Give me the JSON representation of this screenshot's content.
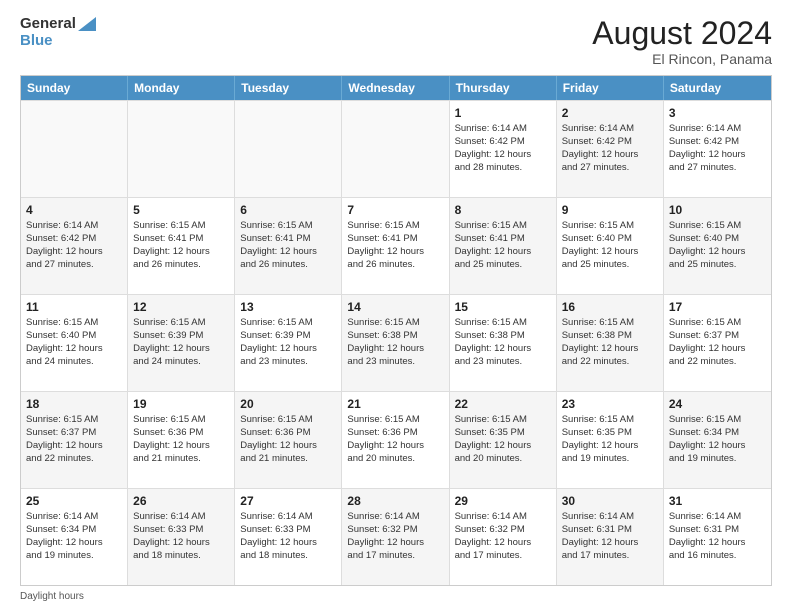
{
  "header": {
    "logo_line1": "General",
    "logo_line2": "Blue",
    "month_year": "August 2024",
    "location": "El Rincon, Panama"
  },
  "days_of_week": [
    "Sunday",
    "Monday",
    "Tuesday",
    "Wednesday",
    "Thursday",
    "Friday",
    "Saturday"
  ],
  "footer": {
    "note": "Daylight hours"
  },
  "weeks": [
    [
      {
        "day": "",
        "info": "",
        "shaded": false
      },
      {
        "day": "",
        "info": "",
        "shaded": false
      },
      {
        "day": "",
        "info": "",
        "shaded": false
      },
      {
        "day": "",
        "info": "",
        "shaded": false
      },
      {
        "day": "1",
        "info": "Sunrise: 6:14 AM\nSunset: 6:42 PM\nDaylight: 12 hours\nand 28 minutes.",
        "shaded": false
      },
      {
        "day": "2",
        "info": "Sunrise: 6:14 AM\nSunset: 6:42 PM\nDaylight: 12 hours\nand 27 minutes.",
        "shaded": true
      },
      {
        "day": "3",
        "info": "Sunrise: 6:14 AM\nSunset: 6:42 PM\nDaylight: 12 hours\nand 27 minutes.",
        "shaded": false
      }
    ],
    [
      {
        "day": "4",
        "info": "Sunrise: 6:14 AM\nSunset: 6:42 PM\nDaylight: 12 hours\nand 27 minutes.",
        "shaded": true
      },
      {
        "day": "5",
        "info": "Sunrise: 6:15 AM\nSunset: 6:41 PM\nDaylight: 12 hours\nand 26 minutes.",
        "shaded": false
      },
      {
        "day": "6",
        "info": "Sunrise: 6:15 AM\nSunset: 6:41 PM\nDaylight: 12 hours\nand 26 minutes.",
        "shaded": true
      },
      {
        "day": "7",
        "info": "Sunrise: 6:15 AM\nSunset: 6:41 PM\nDaylight: 12 hours\nand 26 minutes.",
        "shaded": false
      },
      {
        "day": "8",
        "info": "Sunrise: 6:15 AM\nSunset: 6:41 PM\nDaylight: 12 hours\nand 25 minutes.",
        "shaded": true
      },
      {
        "day": "9",
        "info": "Sunrise: 6:15 AM\nSunset: 6:40 PM\nDaylight: 12 hours\nand 25 minutes.",
        "shaded": false
      },
      {
        "day": "10",
        "info": "Sunrise: 6:15 AM\nSunset: 6:40 PM\nDaylight: 12 hours\nand 25 minutes.",
        "shaded": true
      }
    ],
    [
      {
        "day": "11",
        "info": "Sunrise: 6:15 AM\nSunset: 6:40 PM\nDaylight: 12 hours\nand 24 minutes.",
        "shaded": false
      },
      {
        "day": "12",
        "info": "Sunrise: 6:15 AM\nSunset: 6:39 PM\nDaylight: 12 hours\nand 24 minutes.",
        "shaded": true
      },
      {
        "day": "13",
        "info": "Sunrise: 6:15 AM\nSunset: 6:39 PM\nDaylight: 12 hours\nand 23 minutes.",
        "shaded": false
      },
      {
        "day": "14",
        "info": "Sunrise: 6:15 AM\nSunset: 6:38 PM\nDaylight: 12 hours\nand 23 minutes.",
        "shaded": true
      },
      {
        "day": "15",
        "info": "Sunrise: 6:15 AM\nSunset: 6:38 PM\nDaylight: 12 hours\nand 23 minutes.",
        "shaded": false
      },
      {
        "day": "16",
        "info": "Sunrise: 6:15 AM\nSunset: 6:38 PM\nDaylight: 12 hours\nand 22 minutes.",
        "shaded": true
      },
      {
        "day": "17",
        "info": "Sunrise: 6:15 AM\nSunset: 6:37 PM\nDaylight: 12 hours\nand 22 minutes.",
        "shaded": false
      }
    ],
    [
      {
        "day": "18",
        "info": "Sunrise: 6:15 AM\nSunset: 6:37 PM\nDaylight: 12 hours\nand 22 minutes.",
        "shaded": true
      },
      {
        "day": "19",
        "info": "Sunrise: 6:15 AM\nSunset: 6:36 PM\nDaylight: 12 hours\nand 21 minutes.",
        "shaded": false
      },
      {
        "day": "20",
        "info": "Sunrise: 6:15 AM\nSunset: 6:36 PM\nDaylight: 12 hours\nand 21 minutes.",
        "shaded": true
      },
      {
        "day": "21",
        "info": "Sunrise: 6:15 AM\nSunset: 6:36 PM\nDaylight: 12 hours\nand 20 minutes.",
        "shaded": false
      },
      {
        "day": "22",
        "info": "Sunrise: 6:15 AM\nSunset: 6:35 PM\nDaylight: 12 hours\nand 20 minutes.",
        "shaded": true
      },
      {
        "day": "23",
        "info": "Sunrise: 6:15 AM\nSunset: 6:35 PM\nDaylight: 12 hours\nand 19 minutes.",
        "shaded": false
      },
      {
        "day": "24",
        "info": "Sunrise: 6:15 AM\nSunset: 6:34 PM\nDaylight: 12 hours\nand 19 minutes.",
        "shaded": true
      }
    ],
    [
      {
        "day": "25",
        "info": "Sunrise: 6:14 AM\nSunset: 6:34 PM\nDaylight: 12 hours\nand 19 minutes.",
        "shaded": false
      },
      {
        "day": "26",
        "info": "Sunrise: 6:14 AM\nSunset: 6:33 PM\nDaylight: 12 hours\nand 18 minutes.",
        "shaded": true
      },
      {
        "day": "27",
        "info": "Sunrise: 6:14 AM\nSunset: 6:33 PM\nDaylight: 12 hours\nand 18 minutes.",
        "shaded": false
      },
      {
        "day": "28",
        "info": "Sunrise: 6:14 AM\nSunset: 6:32 PM\nDaylight: 12 hours\nand 17 minutes.",
        "shaded": true
      },
      {
        "day": "29",
        "info": "Sunrise: 6:14 AM\nSunset: 6:32 PM\nDaylight: 12 hours\nand 17 minutes.",
        "shaded": false
      },
      {
        "day": "30",
        "info": "Sunrise: 6:14 AM\nSunset: 6:31 PM\nDaylight: 12 hours\nand 17 minutes.",
        "shaded": true
      },
      {
        "day": "31",
        "info": "Sunrise: 6:14 AM\nSunset: 6:31 PM\nDaylight: 12 hours\nand 16 minutes.",
        "shaded": false
      }
    ]
  ]
}
